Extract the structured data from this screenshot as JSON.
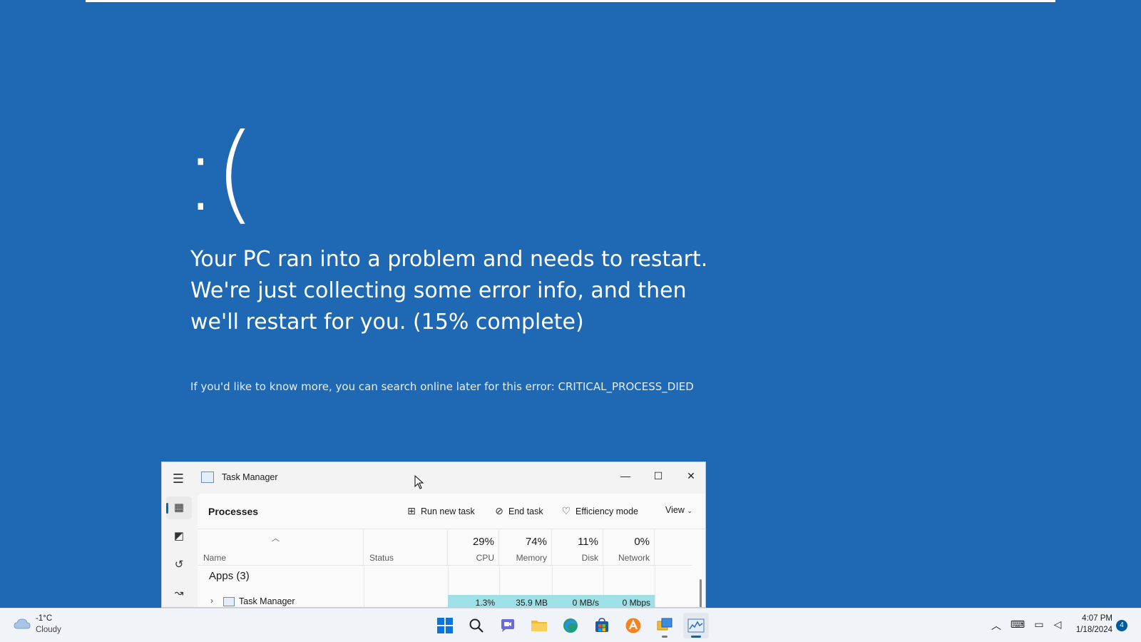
{
  "bsod": {
    "face": ":(",
    "line1": "Your PC ran into a problem and needs to restart.",
    "line2": "We're just collecting some error info, and then",
    "line3": "we'll restart for you. (15% complete)",
    "more_info": "If you'd like to know more, you can search online later for this error: CRITICAL_PROCESS_DIED",
    "progress_percent": 15
  },
  "task_manager": {
    "title": "Task Manager",
    "page_title": "Processes",
    "toolbar": {
      "run_new_task": "Run new task",
      "end_task": "End task",
      "efficiency_mode": "Efficiency mode",
      "view": "View"
    },
    "columns": {
      "name": "Name",
      "status": "Status",
      "cpu": {
        "pct": "29%",
        "label": "CPU"
      },
      "memory": {
        "pct": "74%",
        "label": "Memory"
      },
      "disk": {
        "pct": "11%",
        "label": "Disk"
      },
      "network": {
        "pct": "0%",
        "label": "Network"
      }
    },
    "group_label": "Apps (3)",
    "rows": [
      {
        "name": "Task Manager",
        "cpu": "1.3%",
        "memory": "35.9 MB",
        "disk": "0 MB/s",
        "network": "0 Mbps"
      }
    ],
    "heat_color": "#9fe0e6"
  },
  "taskbar": {
    "weather": {
      "temp": "-1°C",
      "desc": "Cloudy"
    },
    "clock": {
      "time": "4:07 PM",
      "date": "1/18/2024"
    },
    "notification_count": "4",
    "apps": [
      "start-icon",
      "search-icon",
      "chat-icon",
      "file-explorer-icon",
      "edge-icon",
      "store-icon",
      "avast-icon",
      "remote-desktop-icon",
      "task-manager-icon"
    ]
  },
  "colors": {
    "bsod_background": "#1f68b4",
    "accent": "#0067c0"
  }
}
